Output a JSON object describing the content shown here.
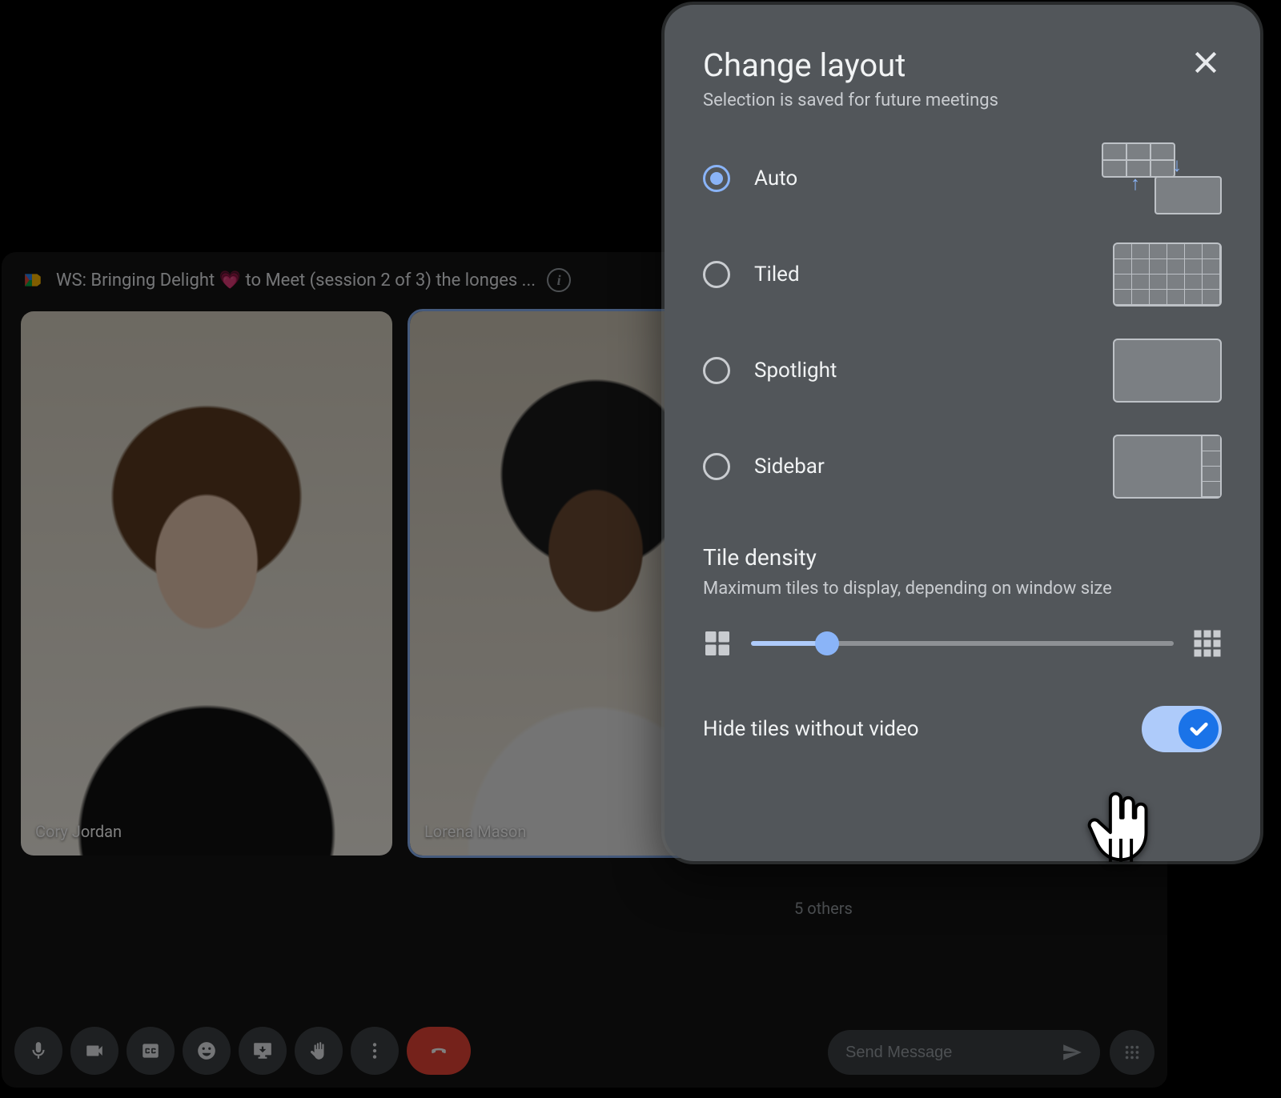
{
  "meeting": {
    "title": "WS: Bringing Delight 💗 to Meet (session 2 of 3) the longes ...",
    "participants": [
      {
        "name": "Cory Jordan",
        "selected": false
      },
      {
        "name": "Lorena Mason",
        "selected": true
      }
    ],
    "others_label": "5 others",
    "message_placeholder": "Send Message"
  },
  "layout_panel": {
    "title": "Change layout",
    "subtitle": "Selection is saved for future meetings",
    "options": [
      {
        "label": "Auto"
      },
      {
        "label": "Tiled"
      },
      {
        "label": "Spotlight"
      },
      {
        "label": "Sidebar"
      }
    ],
    "selected_option_index": 0,
    "density": {
      "title": "Tile density",
      "subtitle": "Maximum tiles to display, depending on window size",
      "percent": 18
    },
    "hide_toggle": {
      "label": "Hide tiles without video",
      "on": true
    }
  }
}
